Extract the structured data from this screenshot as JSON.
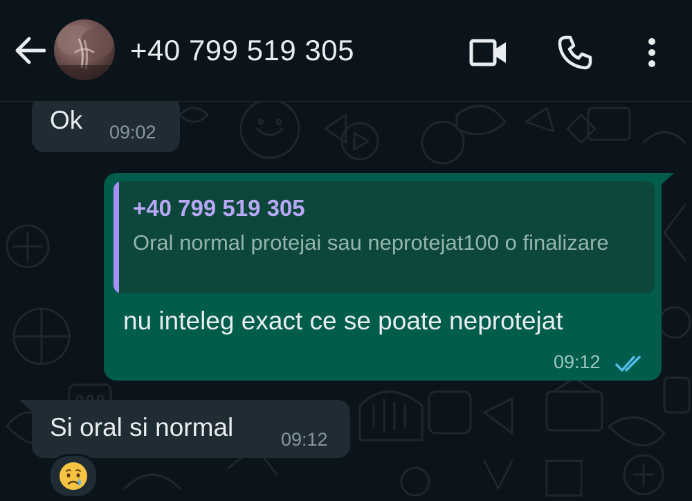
{
  "header": {
    "contact_name": "+40 799 519 305",
    "icons": {
      "back": "arrow-left-icon",
      "video": "video-camera-icon",
      "call": "phone-icon",
      "menu": "more-vertical-icon"
    }
  },
  "messages": [
    {
      "direction": "incoming",
      "text": "Ok",
      "time": "09:02"
    },
    {
      "direction": "outgoing",
      "quoted": {
        "author": "+40 799 519 305",
        "text": "Oral normal protejai sau neprotejat100 o finalizare"
      },
      "text": "nu inteleg exact ce se poate neprotejat",
      "time": "09:12",
      "status": "read"
    },
    {
      "direction": "incoming",
      "text": "Si oral si normal",
      "time": "09:12",
      "reaction": "😢"
    }
  ],
  "colors": {
    "background": "#0b141a",
    "incoming_bubble": "#202c33",
    "outgoing_bubble": "#005c4b",
    "quote_accent": "#a591f5",
    "read_ticks": "#53bdeb"
  }
}
